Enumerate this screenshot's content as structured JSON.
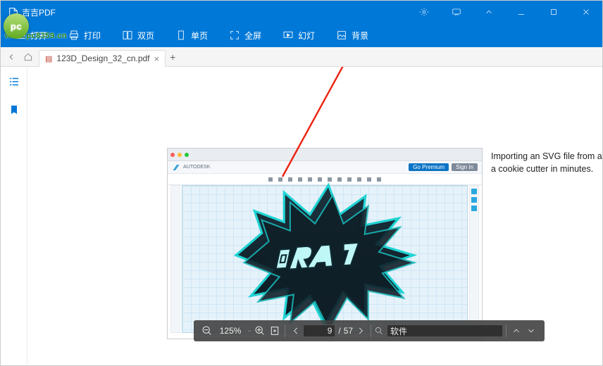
{
  "app": {
    "title": "吉吉PDF"
  },
  "toolbar": {
    "open": "打开",
    "print": "打印",
    "dual": "双页",
    "single": "单页",
    "fullscreen": "全屏",
    "slideshow": "幻灯",
    "background": "背景"
  },
  "tab": {
    "name": "123D_Design_32_cn.pdf"
  },
  "document": {
    "side_text_line1": "Importing an SVG file from a comic",
    "side_text_line2": "a cookie cutter in minutes.",
    "embedded_header_brand": "AUTODESK",
    "embedded_btn_premium": "Go Premium",
    "embedded_btn_signin": "Sign In"
  },
  "statusbar": {
    "zoom": "125%",
    "page_current": "9",
    "page_sep": "/",
    "page_total": "57",
    "search_value": "软件"
  },
  "watermark": {
    "text": "www.pc8359.cn"
  }
}
